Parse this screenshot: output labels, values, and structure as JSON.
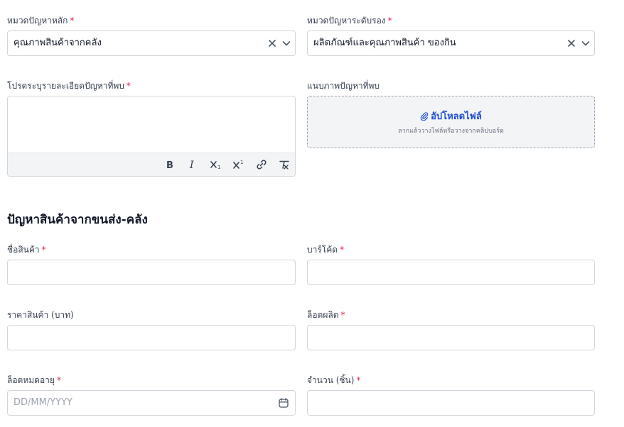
{
  "problem": {
    "main_category": {
      "label": "หมวดปัญหาหลัก",
      "required_mark": "*",
      "value": "คุณภาพสินค้าจากคลัง",
      "clear_icon": "close-icon",
      "chevron_icon": "chevron-down-icon"
    },
    "sub_category": {
      "label": "หมวดปัญหาระดับรอง",
      "required_mark": "*",
      "value": "ผลิตภัณฑ์และคุณภาพสินค้า ของกิน",
      "clear_icon": "close-icon",
      "chevron_icon": "chevron-down-icon"
    },
    "details": {
      "label": "โปรดระบุรายละเอียดปัญหาที่พบ",
      "required_mark": "*",
      "value": "",
      "toolbar": [
        "bold-icon",
        "italic-icon",
        "subscript-icon",
        "superscript-icon",
        "link-icon",
        "clear-format-icon"
      ]
    },
    "attachment": {
      "label": "แนบภาพปัญหาที่พบ",
      "upload_label": "อัปโหลดไฟล์",
      "upload_hint": "ลากแล้ววางไฟล์หรือวางจากคลิปบอร์ด",
      "accent": "#1d4ed8"
    }
  },
  "section": {
    "title": "ปัญหาสินค้าจากขนส่ง-คลัง"
  },
  "product": {
    "name": {
      "label": "ชื่อสินค้า",
      "required_mark": "*",
      "value": ""
    },
    "barcode": {
      "label": "บาร์โค้ด",
      "required_mark": "*",
      "value": ""
    },
    "price": {
      "label": "ราคาสินค้า (บาท)",
      "value": ""
    },
    "lot": {
      "label": "ล็อตผลิต",
      "required_mark": "*",
      "value": ""
    },
    "expiry": {
      "label": "ล็อตหมดอายุ",
      "required_mark": "*",
      "placeholder": "DD/MM/YYYY",
      "icon": "calendar-icon"
    },
    "quantity": {
      "label": "จำนวน (ชิ้น)",
      "required_mark": "*",
      "value": ""
    }
  },
  "colors": {
    "required": "#e11d48",
    "border": "#d1d5db",
    "upload_bg": "#f3f4f6"
  }
}
